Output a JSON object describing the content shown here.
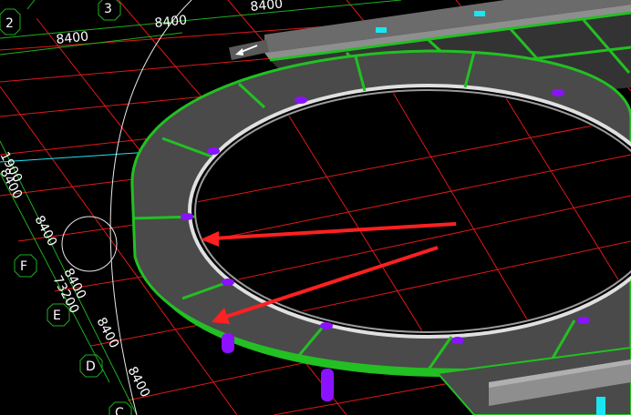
{
  "viewport": {
    "grid_dims": {
      "top_1": "8400",
      "top_2": "8400",
      "top_3": "8400",
      "left_1": "1900",
      "left_2": "8400",
      "left_3": "8400",
      "left_4": "8400",
      "left_total": "73200",
      "left_5": "8400",
      "left_6": "8400"
    },
    "axis_labels": {
      "a2": "2",
      "a3": "3",
      "aF": "F",
      "aE": "E",
      "aD": "D",
      "aC": "C"
    }
  },
  "colors": {
    "background": "#000000",
    "grid_line": "#e21818",
    "dim_line": "#1fae1f",
    "beam_green": "#22c022",
    "slab_gray": "#4a4a4a",
    "column_purple": "#8a12ff",
    "annotation_arrow": "#ff2020",
    "accent_cyan": "#19e6f0",
    "text_white": "#ffffff"
  },
  "icons": {
    "pointer": "arrow-left-icon",
    "annotation": "red-arrow-icon"
  }
}
